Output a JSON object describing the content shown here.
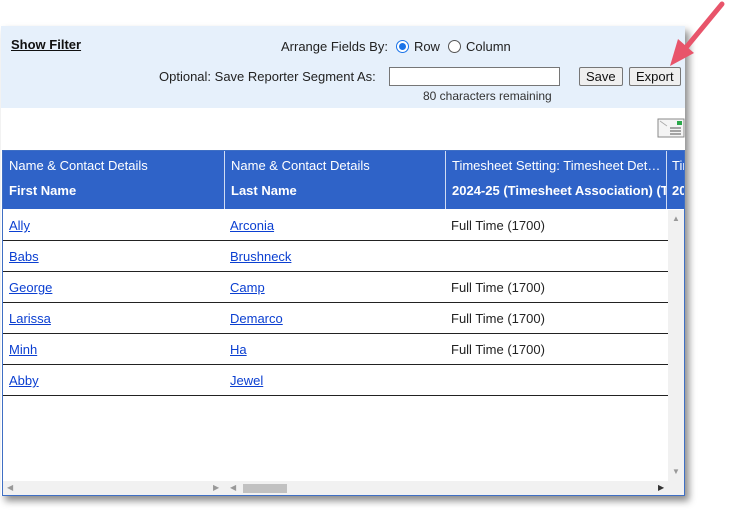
{
  "toolbar": {
    "show_filter": "Show Filter",
    "arrange_label": "Arrange Fields By:",
    "arrange_options": [
      "Row",
      "Column"
    ],
    "arrange_selected": "Row",
    "save_segment_label": "Optional: Save Reporter Segment As:",
    "save_segment_value": "",
    "remaining_text": "80 characters remaining",
    "save_label": "Save",
    "export_label": "Export"
  },
  "grid": {
    "columns": [
      {
        "group": "Name & Contact Details",
        "field": "First Name"
      },
      {
        "group": "Name & Contact Details",
        "field": "Last Name"
      },
      {
        "group": "Timesheet Setting: Timesheet Det…",
        "field": "2024-25 (Timesheet Association) (T"
      },
      {
        "group": "Tir",
        "field": "20"
      }
    ],
    "rows": [
      {
        "first": "Ally",
        "last": "Arconia",
        "timesheet": "Full Time (1700)"
      },
      {
        "first": "Babs",
        "last": "Brushneck",
        "timesheet": ""
      },
      {
        "first": "George",
        "last": "Camp",
        "timesheet": "Full Time (1700)"
      },
      {
        "first": "Larissa",
        "last": "Demarco",
        "timesheet": "Full Time (1700)"
      },
      {
        "first": "Minh",
        "last": "Ha",
        "timesheet": "Full Time (1700)"
      },
      {
        "first": "Abby",
        "last": "Jewel",
        "timesheet": ""
      }
    ]
  },
  "colors": {
    "header_bg": "#2f63c8",
    "toolbar_bg": "#e6f0fb",
    "link": "#0b3fd1",
    "annotation_arrow": "#e8546a"
  },
  "icons": {
    "email": "email-report-icon",
    "annotation": "annotation-arrow-icon"
  }
}
